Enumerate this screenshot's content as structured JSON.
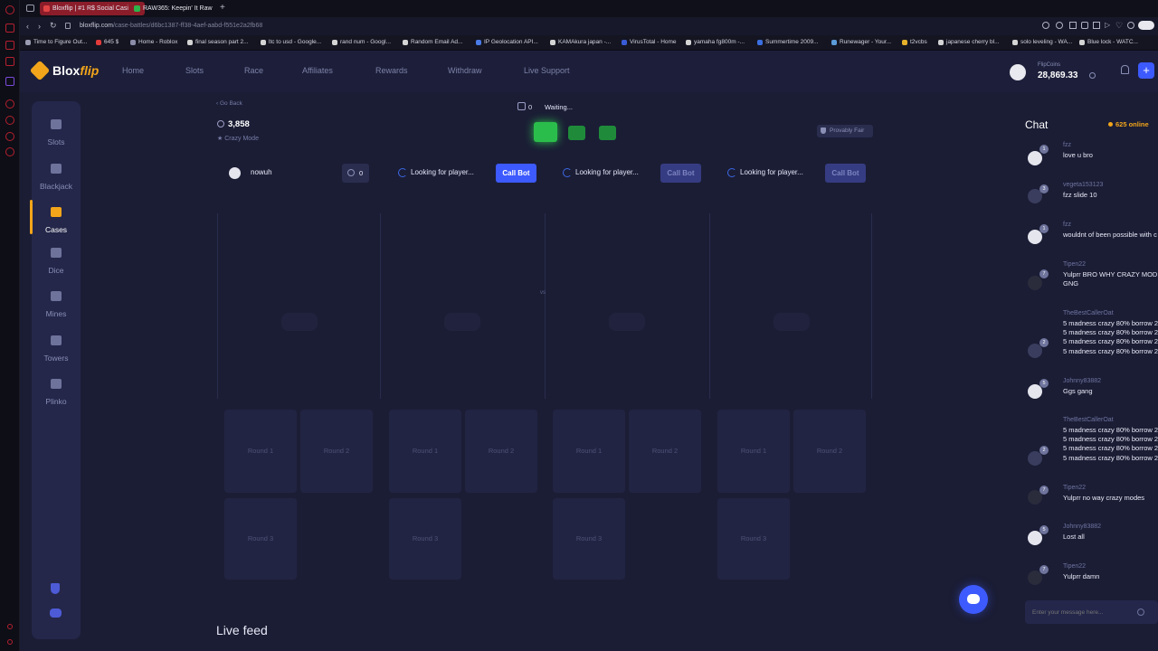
{
  "browser": {
    "tabs": [
      {
        "title": "Bloxflip | #1 R$ Social Casi",
        "favicon_color": "#c53a3a"
      },
      {
        "title": "RAW365: Keepin' It Raw",
        "favicon_color": "#2db34a"
      }
    ],
    "new_tab_label": "+",
    "url_domain": "bloxflip.com",
    "url_path": "/case-battles/d6bc1387-ff38-4aef-aabd-f551e2a2fb68",
    "bookmarks": [
      {
        "label": "Time to Figure Out...",
        "color": "#9a9ab0"
      },
      {
        "label": "645 $",
        "color": "#e33b3b"
      },
      {
        "label": "Home - Roblox",
        "color": "#8a8ca8"
      },
      {
        "label": "final season part 2...",
        "color": "#d4d4d4"
      },
      {
        "label": "ltc to usd - Google...",
        "color": "#d4d4d4"
      },
      {
        "label": "rand num - Googl...",
        "color": "#d4d4d4"
      },
      {
        "label": "Random Email Ad...",
        "color": "#d4d4d4"
      },
      {
        "label": "IP Geolocation API...",
        "color": "#4a7be6"
      },
      {
        "label": "KAMAkura japan -...",
        "color": "#d4d4d4"
      },
      {
        "label": "VirusTotal - Home",
        "color": "#3a5bd6"
      },
      {
        "label": "yamaha fg800m -...",
        "color": "#d4d4d4"
      },
      {
        "label": "Summertime 2009...",
        "color": "#3b6fe0"
      },
      {
        "label": "Runewager - Your...",
        "color": "#5b9bd8"
      },
      {
        "label": "t2vcbs",
        "color": "#e6b02a"
      },
      {
        "label": "japanese cherry bl...",
        "color": "#d4d4d4"
      },
      {
        "label": "solo leveling - WA...",
        "color": "#d4d4d4"
      },
      {
        "label": "Blue lock - WATC...",
        "color": "#d4d4d4"
      }
    ]
  },
  "header": {
    "logo_part1": "Blox",
    "logo_part2": "flip",
    "nav": [
      "Home",
      "Slots",
      "Race",
      "Affiliates",
      "Rewards",
      "Withdraw",
      "Live Support"
    ],
    "balance_label": "FlipCoins",
    "balance_value": "28,869.33",
    "add_button": "+"
  },
  "sidebar": {
    "items": [
      {
        "label": "Slots"
      },
      {
        "label": "Blackjack"
      },
      {
        "label": "Cases",
        "active": true
      },
      {
        "label": "Dice"
      },
      {
        "label": "Mines"
      },
      {
        "label": "Towers"
      },
      {
        "label": "Plinko"
      }
    ]
  },
  "battle": {
    "go_back": "Go Back",
    "total_value": "3,858",
    "mode": "Crazy Mode",
    "round_counter": "0",
    "status": "Waiting...",
    "provably_fair": "Provably Fair",
    "vs_label": "vs",
    "player1": {
      "name": "nowuh",
      "value": "0"
    },
    "slots": [
      {
        "status": "Looking for player...",
        "button": "Call Bot",
        "state": "active"
      },
      {
        "status": "Looking for player...",
        "button": "Call Bot",
        "state": "disabled"
      },
      {
        "status": "Looking for player...",
        "button": "Call Bot",
        "state": "disabled"
      }
    ],
    "round_labels": [
      "Round 1",
      "Round 2",
      "Round 3"
    ]
  },
  "live_feed": {
    "title": "Live feed"
  },
  "chat": {
    "title": "Chat",
    "online": "625 online",
    "input_placeholder": "Enter your message here...",
    "messages": [
      {
        "user": "fzz",
        "level": "1",
        "text": "love u bro"
      },
      {
        "user": "vegeta153123",
        "level": "3",
        "text": "fzz slide 10"
      },
      {
        "user": "fzz",
        "level": "1",
        "text": "wouldnt of been possible with c"
      },
      {
        "user": "Tipen22",
        "level": "7",
        "text": "Yulprr BRO WHY CRAZY MODE\nGNG"
      },
      {
        "user": "TheBestCallerOat",
        "level": "2",
        "text": "5 madness crazy 80% borrow 2\n5 madness crazy 80% borrow 2\n5 madness crazy 80% borrow 2\n5 madness crazy 80% borrow 2"
      },
      {
        "user": "Johnny83882",
        "level": "5",
        "text": "Ggs gang"
      },
      {
        "user": "TheBestCallerOat",
        "level": "2",
        "text": "5 madness crazy 80% borrow 2\n5 madness crazy 80% borrow 2\n5 madness crazy 80% borrow 2\n5 madness crazy 80% borrow 2"
      },
      {
        "user": "Tipen22",
        "level": "7",
        "text": "Yulprr no way crazy modes"
      },
      {
        "user": "Johnny83882",
        "level": "5",
        "text": "Lost all"
      },
      {
        "user": "Tipen22",
        "level": "7",
        "text": "Yulprr damn"
      }
    ]
  },
  "colors": {
    "accent": "#3d5afe",
    "brand": "#f2a51a",
    "online": "#f2a51a",
    "case_green": "#2bbd4b"
  }
}
